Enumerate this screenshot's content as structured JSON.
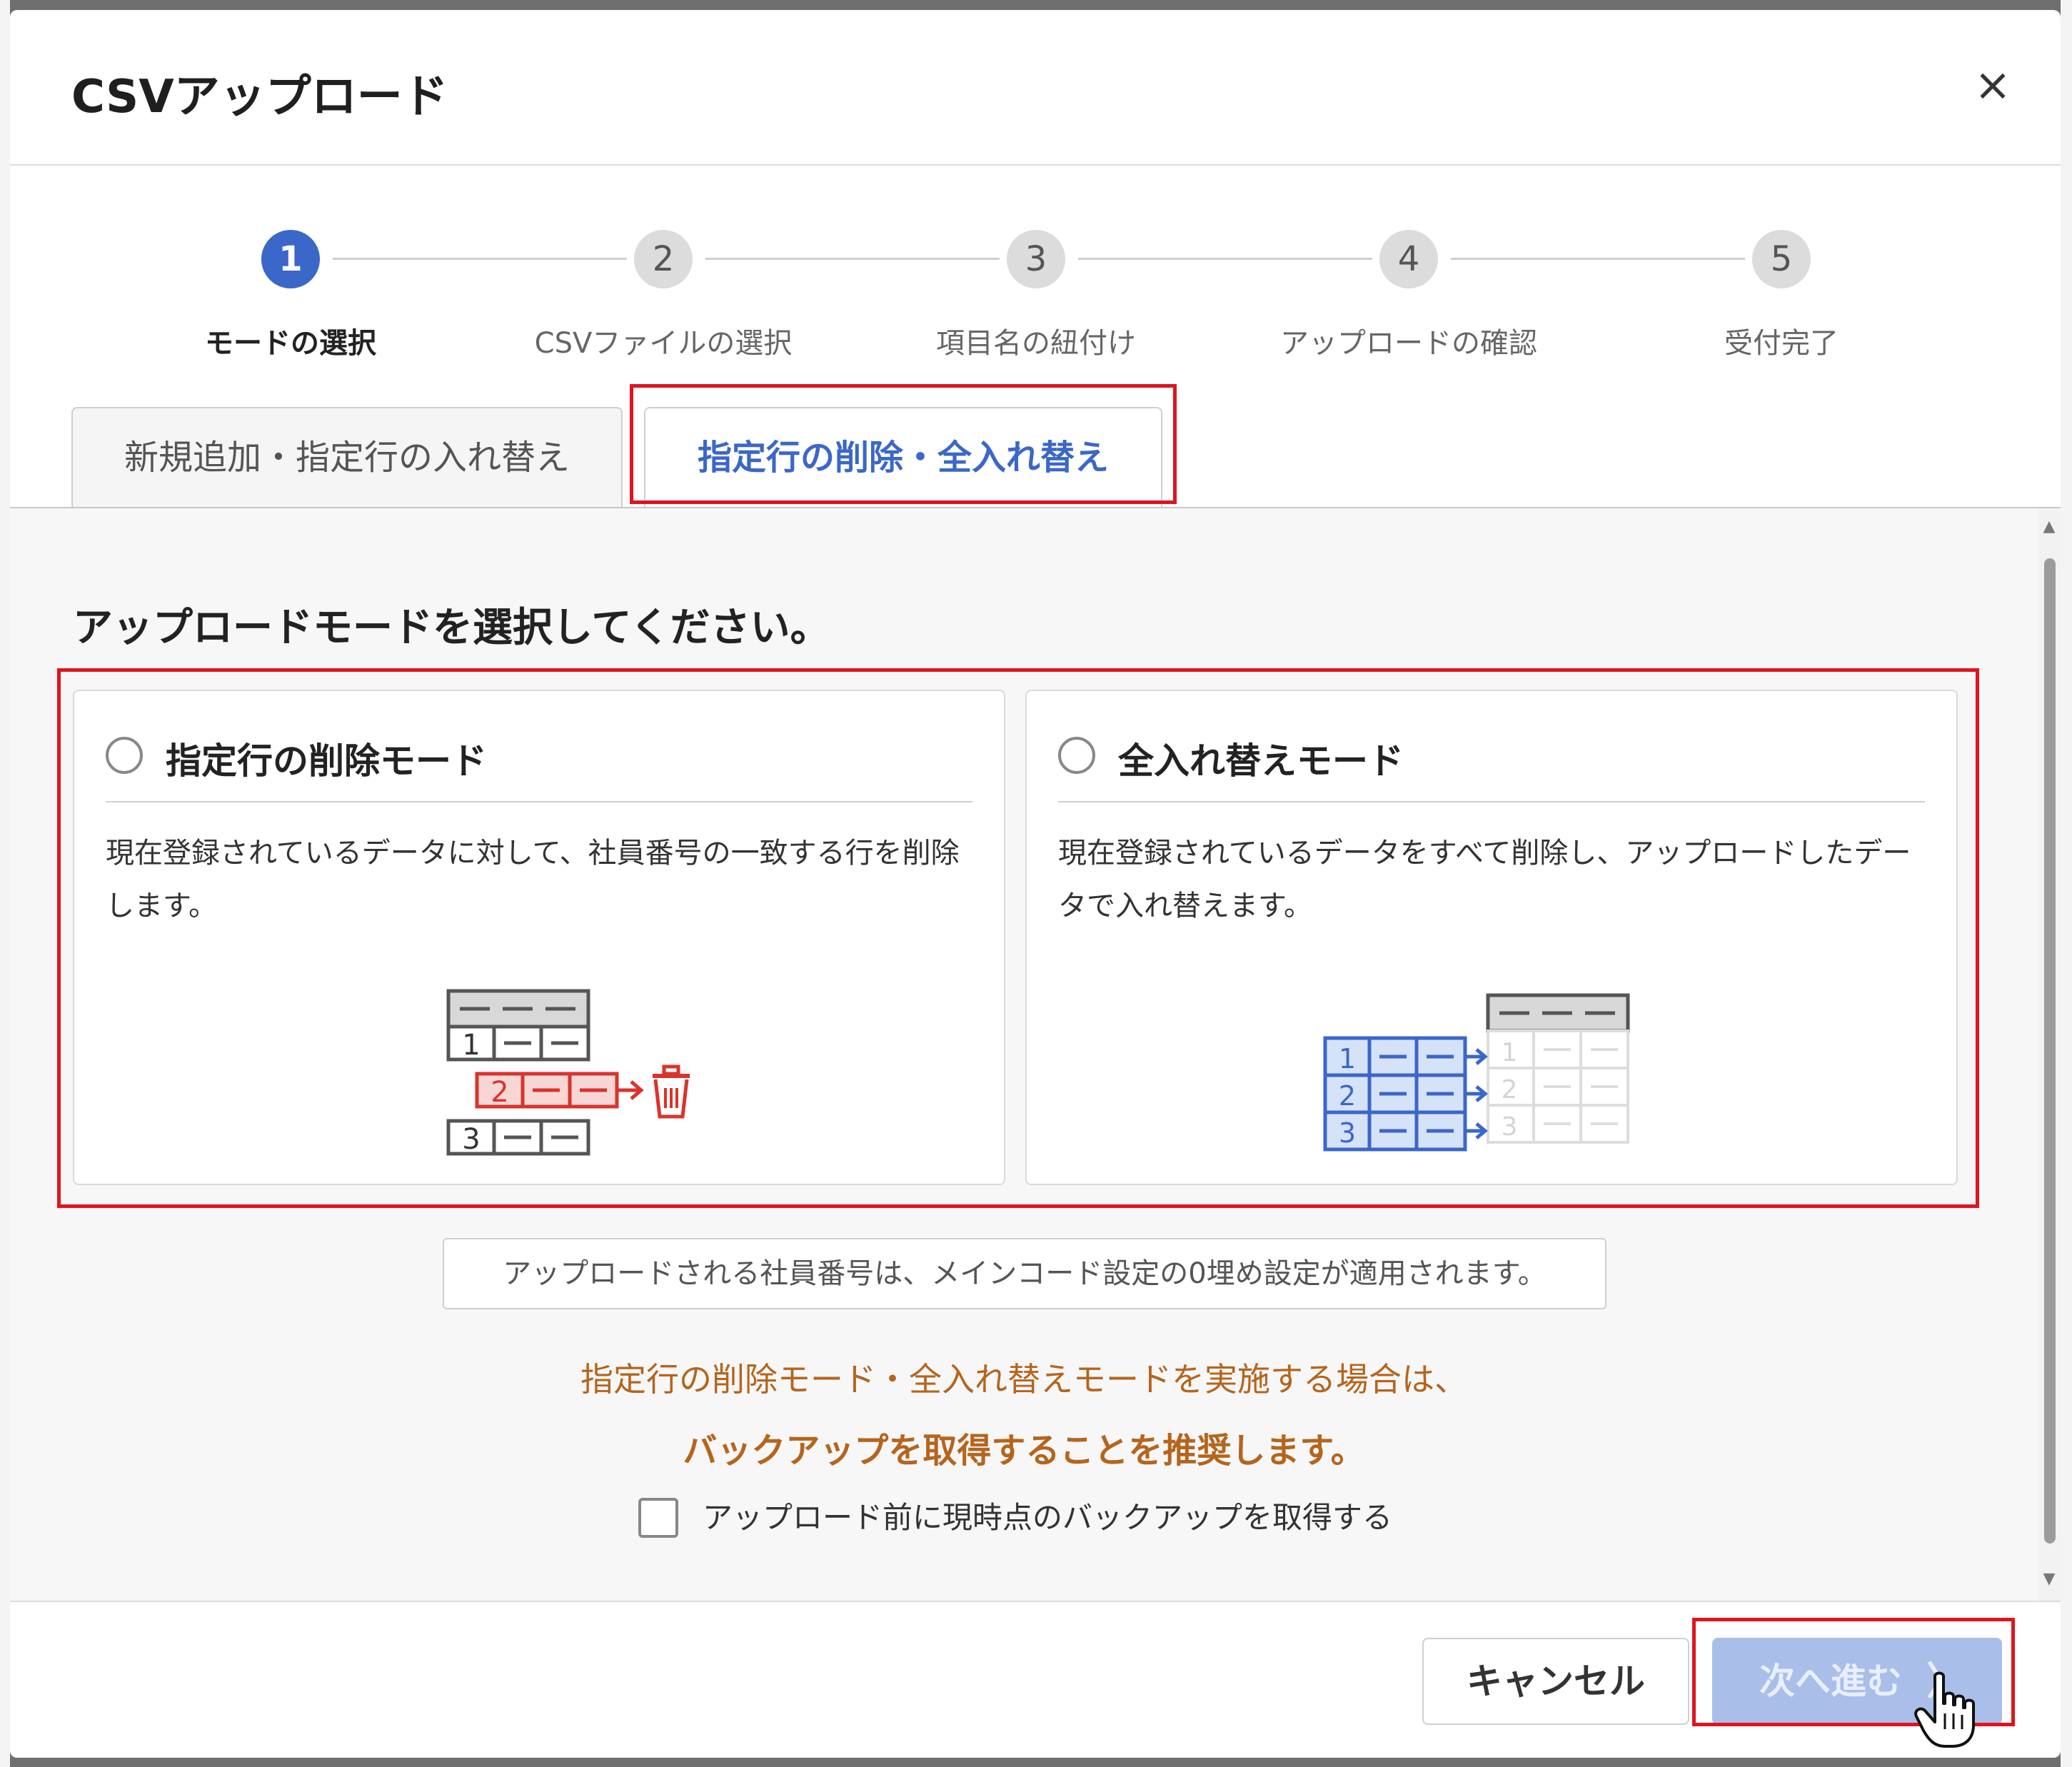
{
  "dialog": {
    "title": "CSVアップロード",
    "close_symbol": "×"
  },
  "steps": [
    {
      "number": "1",
      "label": "モードの選択",
      "active": true
    },
    {
      "number": "2",
      "label": "CSVファイルの選択",
      "active": false
    },
    {
      "number": "3",
      "label": "項目名の紐付け",
      "active": false
    },
    {
      "number": "4",
      "label": "アップロードの確認",
      "active": false
    },
    {
      "number": "5",
      "label": "受付完了",
      "active": false
    }
  ],
  "tabs": [
    {
      "label": "新規追加・指定行の入れ替え",
      "active": false
    },
    {
      "label": "指定行の削除・全入れ替え",
      "active": true
    }
  ],
  "prompt": "アップロードモードを選択してください。",
  "modes": [
    {
      "title": "指定行の削除モード",
      "description": "現在登録されているデータに対して、社員番号の一致する行を削除します。",
      "selected": false,
      "icon": "table-row-delete-icon"
    },
    {
      "title": "全入れ替えモード",
      "description": "現在登録されているデータをすべて削除し、アップロードしたデータで入れ替えます。",
      "selected": false,
      "icon": "table-replace-icon"
    }
  ],
  "illustration_numbers": [
    "1",
    "2",
    "3"
  ],
  "note": "アップロードされる社員番号は、メインコード設定の0埋め設定が適用されます。",
  "warning": {
    "line1": "指定行の削除モード・全入れ替えモードを実施する場合は、",
    "line2": "バックアップを取得することを推奨します。"
  },
  "backup_checkbox": {
    "label": "アップロード前に現時点のバックアップを取得する",
    "checked": false
  },
  "footer": {
    "cancel_label": "キャンセル",
    "next_label": "次へ進む",
    "next_chevron": "〉",
    "next_enabled": false
  },
  "colors": {
    "accent": "#3b67c9",
    "highlight_border": "#e0141e",
    "warning_text": "#b5651d",
    "delete_red": "#d9342b",
    "replace_blue": "#3b67c9",
    "next_disabled_bg": "#a9bfea"
  }
}
